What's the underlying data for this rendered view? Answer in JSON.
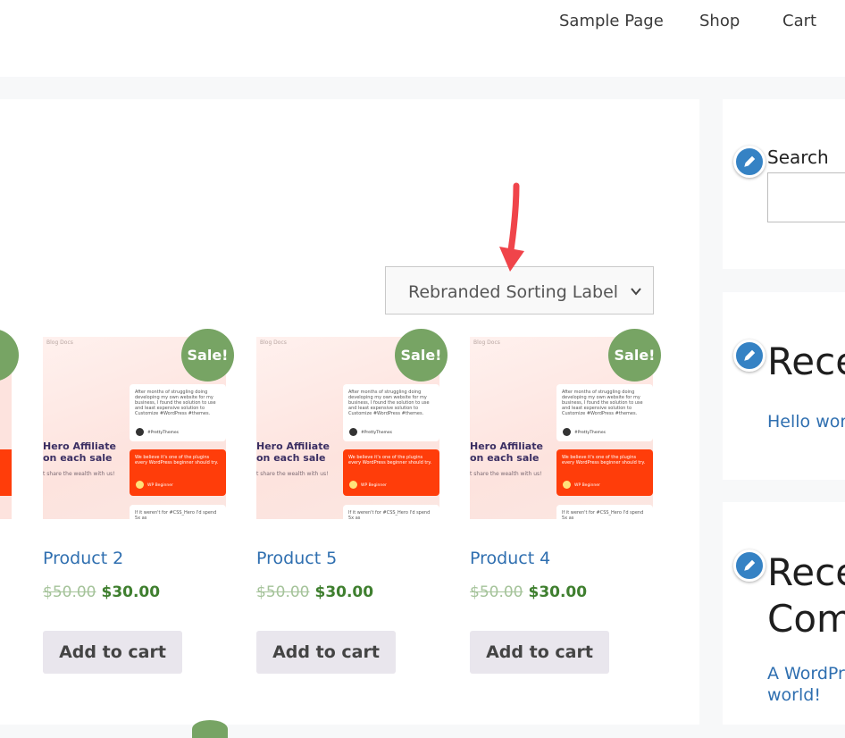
{
  "header": {
    "nav": [
      "Sample Page",
      "Shop",
      "Cart"
    ]
  },
  "shop": {
    "sort_label": "Rebranded Sorting Label",
    "products": [
      {
        "title": "Product 2",
        "regular_price": "$50.00",
        "sale_price": "$30.00",
        "badge": "Sale!",
        "button": "Add to cart"
      },
      {
        "title": "Product 5",
        "regular_price": "$50.00",
        "sale_price": "$30.00",
        "badge": "Sale!",
        "button": "Add to cart"
      },
      {
        "title": "Product 4",
        "regular_price": "$50.00",
        "sale_price": "$30.00",
        "badge": "Sale!",
        "button": "Add to cart"
      }
    ],
    "thumb": {
      "crumbs": "Blog   Docs",
      "hero_line1": "Hero Affiliate",
      "hero_line2": "on each sale",
      "hero_sub": "t share the wealth with us!",
      "card1_text": "After months of struggling doing developing my own website for my business, I found the solution to use and least expensive solution to Customize #WordPress #themes.",
      "card1_who": "#PrettyThemes",
      "card2_text": "We believe it's one of the plugins every WordPress beginner should try.",
      "card2_who": "WP Beginner",
      "card3_text": "If it weren't for #CSS_Hero I'd spend 5x as"
    }
  },
  "sidebar": {
    "search_label": "Search",
    "recent_posts_heading": "Rece",
    "recent_post_link": "Hello wor",
    "recent_comments_heading_1": "Rece",
    "recent_comments_heading_2": "Com",
    "recent_comment_line_1": "A WordPr",
    "recent_comment_line_2": "world!"
  },
  "colors": {
    "link": "#2f6fb0",
    "sale_badge": "#77a464",
    "price": "#3f7f2f",
    "arrow": "#f0444a",
    "edit_icon": "#3582c4"
  }
}
